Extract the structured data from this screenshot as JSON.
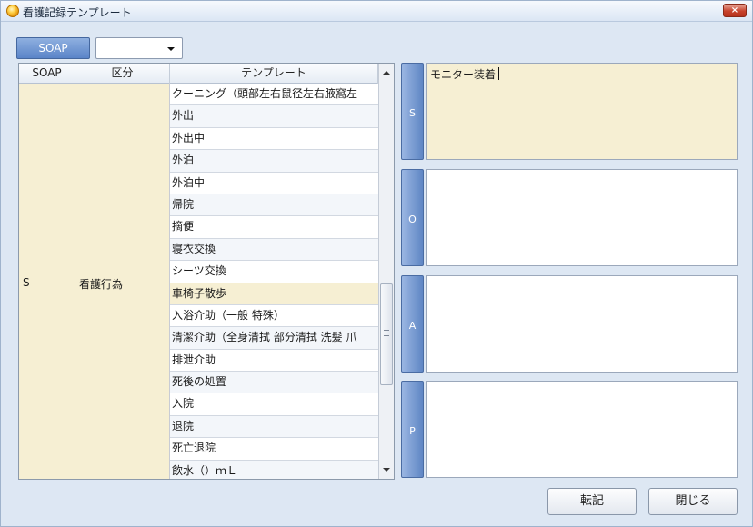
{
  "window": {
    "title": "看護記録テンプレート",
    "close_label": "×"
  },
  "toolbar": {
    "soap_button": "SOAP",
    "filter_select_value": ""
  },
  "grid": {
    "headers": [
      "SOAP",
      "区分",
      "テンプレート"
    ],
    "soap_value": "S",
    "kubun_value": "看護行為",
    "rows": [
      "クーニング（頭部左右鼠径左右腋窩左",
      "外出",
      "外出中",
      "外泊",
      "外泊中",
      "帰院",
      "摘便",
      "寝衣交換",
      "シーツ交換",
      "車椅子散歩",
      "入浴介助（一般 特殊）",
      "清潔介助（全身清拭 部分清拭 洗髪 爪",
      "排泄介助",
      "死後の処置",
      "入院",
      "退院",
      "死亡退院",
      "飲水（）ｍＬ"
    ],
    "selected_row": 9
  },
  "panels": {
    "s": {
      "label": "S",
      "text": "モニター装着"
    },
    "o": {
      "label": "O",
      "text": ""
    },
    "a": {
      "label": "A",
      "text": ""
    },
    "p": {
      "label": "P",
      "text": ""
    }
  },
  "buttons": {
    "transfer": "転記",
    "close": "閉じる"
  }
}
